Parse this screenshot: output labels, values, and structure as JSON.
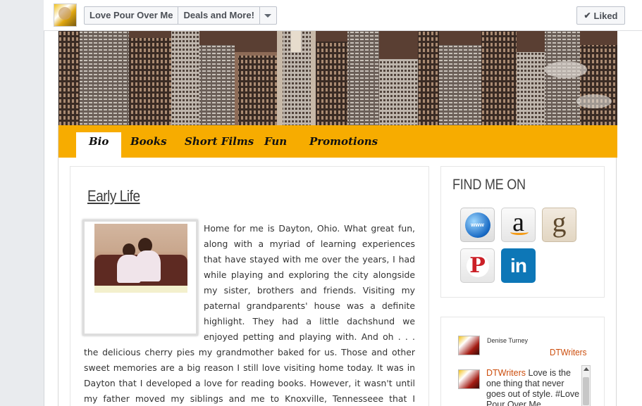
{
  "topbar": {
    "page_name": "Love Pour Over Me",
    "tab_label": "Deals and More!",
    "liked_label": "Liked",
    "check_icon": "✔"
  },
  "nav": {
    "items": [
      {
        "label": "Bio",
        "active": true
      },
      {
        "label": "Books",
        "active": false
      },
      {
        "label": "Short Films",
        "active": false
      },
      {
        "label": "Fun",
        "active": false
      },
      {
        "label": "Promotions",
        "active": false
      }
    ]
  },
  "main": {
    "section_title": "Early Life",
    "bio_paragraph": "Home for me is Dayton, Ohio. What great fun, along with a myriad of learning experiences that have stayed with me over the years, I had while playing and exploring the city alongside my sister, brothers and friends. Visiting my paternal grandparents' house was a definite highlight. They had a little dachshund we enjoyed petting and playing with. And oh . . . the delicious cherry pies my grandmother baked for us. Those and other sweet memories are a big reason I still love visiting home today. It was in Dayton that I developed a love for reading books. However, it wasn't until my father moved my siblings and me to Knoxville, Tennesseee that I realized I was a writer."
  },
  "sidebar": {
    "find_title": "FIND ME ON",
    "social": [
      {
        "name": "website",
        "icon": "globe-icon",
        "label": "www"
      },
      {
        "name": "amazon",
        "icon": "amazon-icon",
        "label": "a"
      },
      {
        "name": "goodreads",
        "icon": "goodreads-icon",
        "label": "g"
      },
      {
        "name": "pinterest",
        "icon": "pinterest-icon",
        "label": "P"
      },
      {
        "name": "linkedin",
        "icon": "linkedin-icon",
        "label": "in"
      }
    ],
    "twitter": {
      "user_name": "Denise Turney",
      "handle": "DTWriters",
      "tweet_handle": "DTWriters",
      "tweet_text": " Love is the one thing that never goes out of style. #Love Pour Over Me"
    }
  },
  "colors": {
    "nav_bar": "#f7ac00",
    "accent_link": "#cc4d0c",
    "linkedin": "#0d77b7",
    "pinterest": "#cb2027"
  }
}
